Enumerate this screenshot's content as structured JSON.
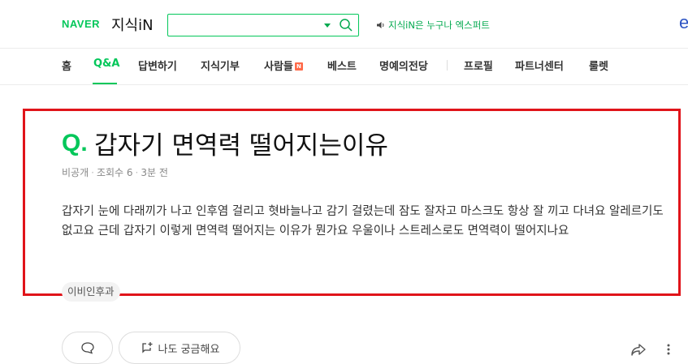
{
  "header": {
    "logo": "NAVER",
    "service": "지식iN",
    "search": {
      "value": "",
      "placeholder": ""
    },
    "notice": "지식iN은 누구나 엑스퍼트",
    "corner_letter": "e"
  },
  "nav": {
    "items": [
      {
        "label": "홈"
      },
      {
        "label": "Q&A",
        "active": true
      },
      {
        "label": "답변하기"
      },
      {
        "label": "지식기부"
      },
      {
        "label": "사람들",
        "badge": "N"
      },
      {
        "label": "베스트"
      },
      {
        "label": "명예의전당"
      },
      {
        "label": "프로필"
      },
      {
        "label": "파트너센터"
      },
      {
        "label": "룰렛"
      }
    ]
  },
  "question": {
    "q_mark": "Q.",
    "title": "갑자기 면역력 떨어지는이유",
    "author": "비공개",
    "views": "조회수 6",
    "time": "3분 전",
    "body": "갑자기 눈에 다래끼가 나고 인후염 걸리고 혓바늘나고 감기 걸렸는데 잠도 잘자고 마스크도 항상 잘 끼고 다녀요 알레르기도 없고요 근데 갑자기 이렇게 면역력 떨어지는 이유가 뭔가요 우울이나 스트레스로도 면역력이 떨어지나요",
    "tag": "이비인후과"
  },
  "actions": {
    "curious_label": "나도 궁금해요"
  },
  "colors": {
    "brand": "#03c75a",
    "highlight": "#e0141a"
  }
}
